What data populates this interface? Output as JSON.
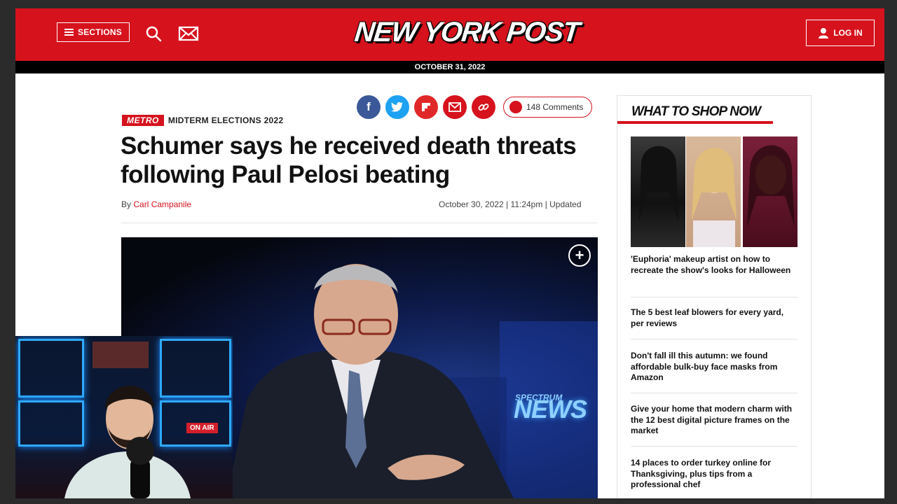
{
  "header": {
    "sections_label": "SECTIONS",
    "logo_text": "NEW YORK POST",
    "login_label": "LOG IN",
    "date": "OCTOBER 31, 2022"
  },
  "share": {
    "buttons": [
      "facebook-icon",
      "twitter-icon",
      "flipboard-icon",
      "email-icon",
      "link-icon"
    ],
    "colors": {
      "facebook": "#3b5998",
      "twitter": "#1da1f2",
      "flipboard": "#e12828",
      "email": "#d6121d",
      "link": "#d6121d"
    },
    "comments_label": "148 Comments"
  },
  "article": {
    "tag": "METRO",
    "section": "MIDTERM ELECTIONS 2022",
    "headline": "Schumer says he received death threats following Paul Pelosi beating",
    "byline_prefix": "By",
    "author": "Carl Campanile",
    "date": "October 30, 2022",
    "time": "11:24pm",
    "updated": "Updated",
    "image_sign_small": "SPECTRUM",
    "image_sign": "NEWS"
  },
  "sidebar": {
    "title": "WHAT TO SHOP NOW",
    "items": [
      "'Euphoria' makeup artist on how to recreate the show's looks for Halloween",
      "The 5 best leaf blowers for every yard, per reviews",
      "Don't fall ill this autumn: we found affordable bulk-buy face masks from Amazon",
      "Give your home that modern charm with the 12 best digital picture frames on the market",
      "14 places to order turkey online for Thanksgiving, plus tips from a professional chef"
    ]
  },
  "webcam": {
    "sign": "ON AIR"
  },
  "colors": {
    "brand_red": "#d6121d",
    "black_bar": "#000000",
    "page_bg": "#ffffff"
  }
}
